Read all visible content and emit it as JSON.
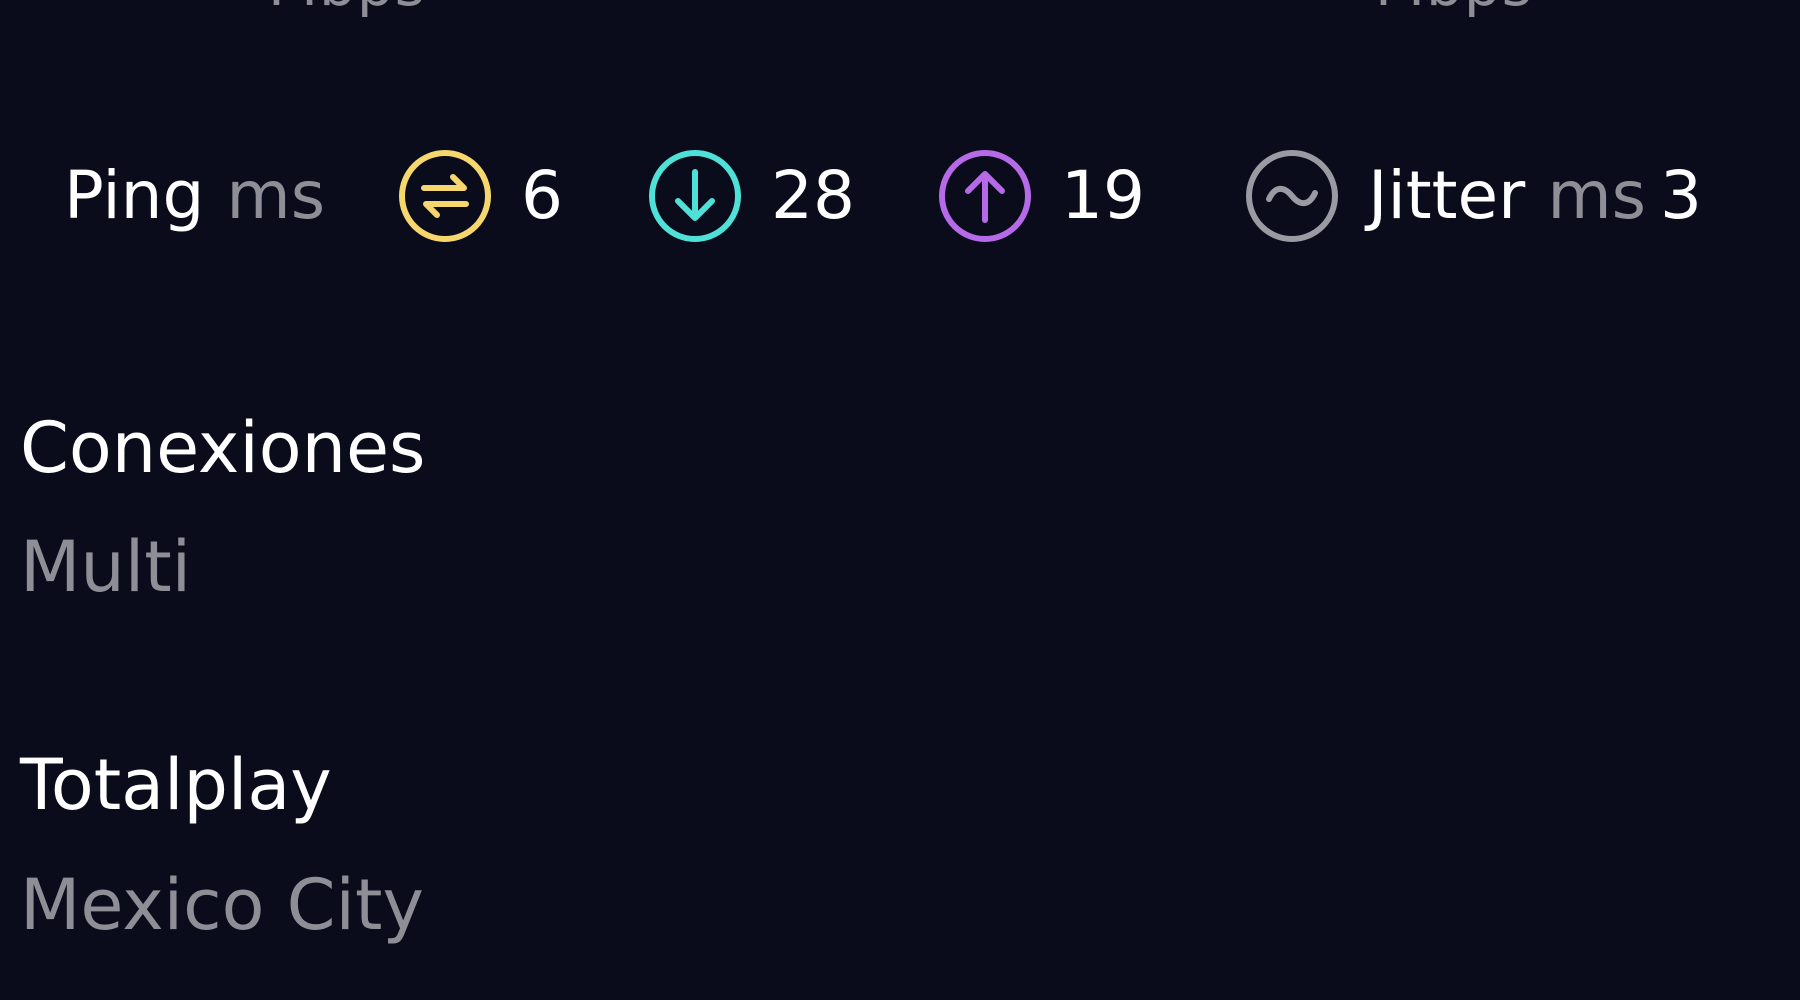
{
  "header": {
    "download_unit": "Mbps",
    "upload_unit": "Mbps"
  },
  "metrics": {
    "ping": {
      "label": "Ping",
      "unit": "ms",
      "icon": "ping-icon",
      "color": "#f5d76e"
    },
    "idle_ping": {
      "value": "6",
      "icon": "idle-latency-icon",
      "color": "#f5d76e"
    },
    "download_ping": {
      "value": "28",
      "icon": "download-arrow-icon",
      "color": "#4fe0d8"
    },
    "upload_ping": {
      "value": "19",
      "icon": "upload-arrow-icon",
      "color": "#b66ae8"
    },
    "jitter": {
      "label": "Jitter",
      "unit": "ms",
      "value": "3",
      "icon": "jitter-wave-icon",
      "color": "#9a9aa3"
    }
  },
  "connections": {
    "title": "Conexiones",
    "value": "Multi"
  },
  "server": {
    "provider": "Totalplay",
    "location": "Mexico City"
  }
}
